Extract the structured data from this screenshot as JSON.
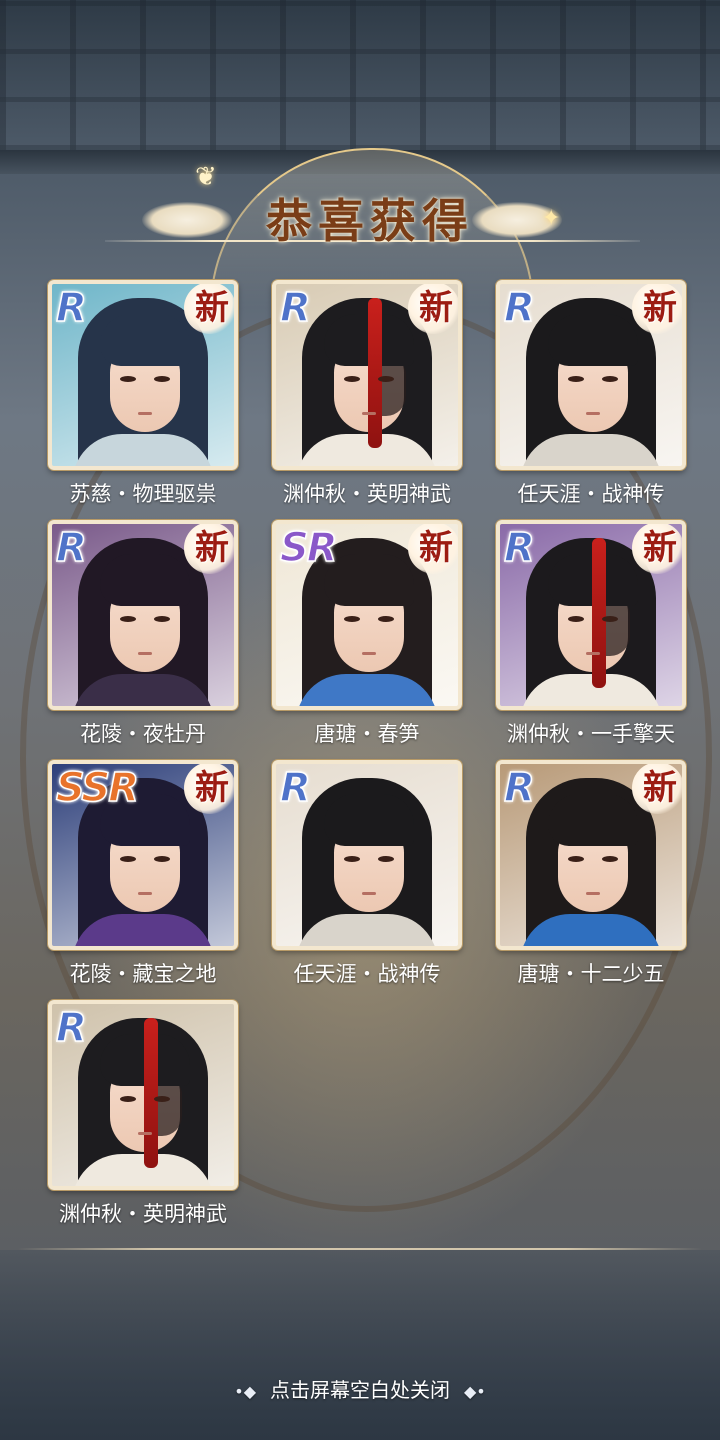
{
  "header": {
    "title": "恭喜获得",
    "decor_icon": "butterfly-icon"
  },
  "theme": {
    "title_color": "#7a3d17",
    "rarity_colors": {
      "R": "#4f73c9",
      "SR": "#8a58c9",
      "SSR": "#e8732b"
    },
    "new_badge_color": "#9c1c12"
  },
  "rewards": [
    {
      "name": "苏慈・物理驱祟",
      "rarity": "R",
      "badge": "新",
      "hair": "#26344a",
      "bg": "#6fb6c9",
      "robe": "#c7d6dc"
    },
    {
      "name": "渊仲秋・英明神武",
      "rarity": "R",
      "badge": "新",
      "hair": "#1d1c1f",
      "bg": "#d8cbb4",
      "robe": "#efe9df"
    },
    {
      "name": "任天涯・战神传",
      "rarity": "R",
      "badge": "新",
      "hair": "#1b1a1c",
      "bg": "#e6ddd0",
      "robe": "#d9d4cb"
    },
    {
      "name": "花陵・夜牡丹",
      "rarity": "R",
      "badge": "新",
      "hair": "#211825",
      "bg": "#7a5a8a",
      "robe": "#3a2e48"
    },
    {
      "name": "唐瑭・春笋",
      "rarity": "SR",
      "badge": "新",
      "hair": "#231d1e",
      "bg": "#efe7d6",
      "robe": "#3f78c6"
    },
    {
      "name": "渊仲秋・一手擎天",
      "rarity": "R",
      "badge": "新",
      "hair": "#1c1a1d",
      "bg": "#8a6aa8",
      "robe": "#efe9df"
    },
    {
      "name": "花陵・藏宝之地",
      "rarity": "SSR",
      "badge": "新",
      "hair": "#1e1b33",
      "bg": "#2d3f7a",
      "robe": "#5b3a8a"
    },
    {
      "name": "任天涯・战神传",
      "rarity": "R",
      "badge": "",
      "hair": "#1b1a1c",
      "bg": "#e6ddd0",
      "robe": "#d9d4cb"
    },
    {
      "name": "唐瑭・十二少五",
      "rarity": "R",
      "badge": "新",
      "hair": "#1e1a1a",
      "bg": "#b89a78",
      "robe": "#2f6fbf"
    },
    {
      "name": "渊仲秋・英明神武",
      "rarity": "R",
      "badge": "",
      "hair": "#1d1c1f",
      "bg": "#cfc2ab",
      "robe": "#efe9df"
    }
  ],
  "footer": {
    "hint": "点击屏幕空白处关闭",
    "ornament_left": "•◆",
    "ornament_right": "◆•"
  }
}
